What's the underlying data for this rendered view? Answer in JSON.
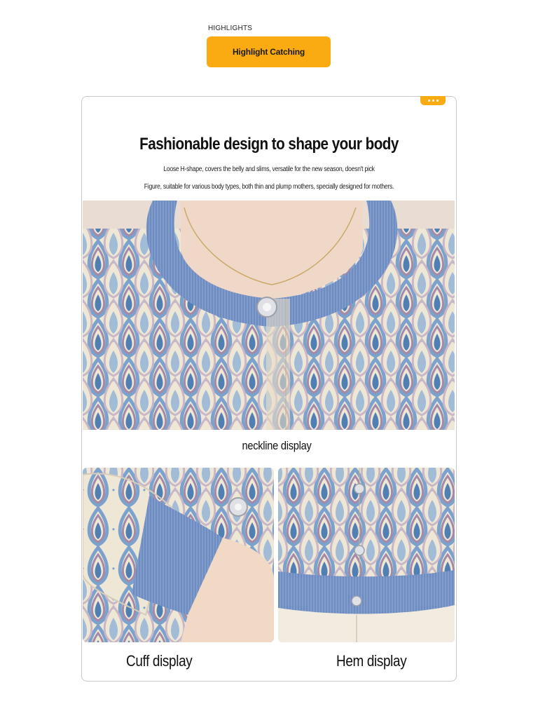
{
  "header": {
    "section_label": "HIGHLIGHTS",
    "button_label": "Highlight Catching"
  },
  "card": {
    "headline": "Fashionable design to shape your body",
    "subtitle_line1": "Loose H-shape, covers the belly and slims, versatile for the new season, doesn't pick",
    "subtitle_line2": "Figure, suitable for various body types, both thin and plump mothers, specially designed for mothers.",
    "more_icon": "more-dots-icon"
  },
  "photos": {
    "neckline_caption": "neckline display",
    "cuff_caption": "Cuff display",
    "hem_caption": "Hem display"
  },
  "colors": {
    "accent": "#fbab12",
    "ribbing_blue": "#7f9bcc",
    "fabric_cream": "#efe7d6",
    "pattern_blue": "#4f7fb3",
    "pattern_mauve": "#a48aa6"
  }
}
